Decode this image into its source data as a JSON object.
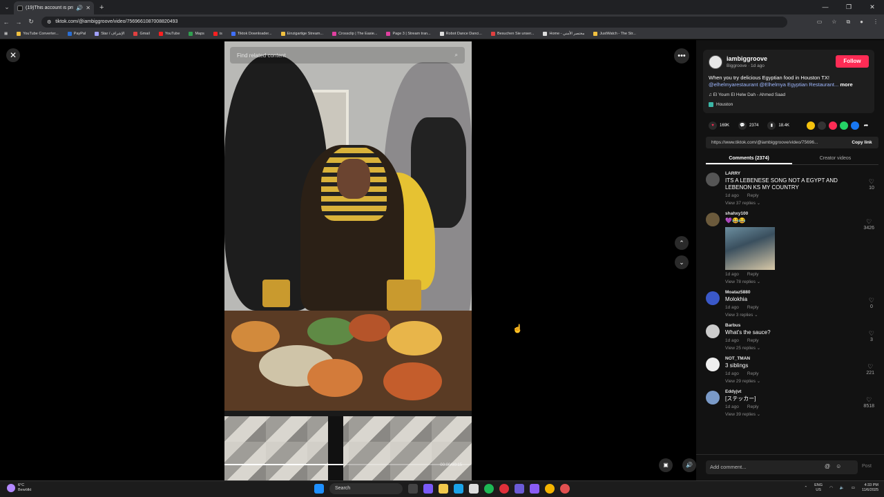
{
  "browser": {
    "tab_title": "(19)This account is private.",
    "url": "tiktok.com/@iambiggroove/video/7569661087008820493",
    "bookmarks": [
      {
        "label": "YouTube Converter...",
        "color": "#f0c040"
      },
      {
        "label": "PayPal",
        "color": "#2a6fd6"
      },
      {
        "label": "Star / الإشراف",
        "color": "#a0a0ff"
      },
      {
        "label": "Gmail",
        "color": "#e04040"
      },
      {
        "label": "YouTube",
        "color": "#ff2020"
      },
      {
        "label": "Maps",
        "color": "#30a050"
      },
      {
        "label": "is",
        "color": "#ff2020"
      },
      {
        "label": "Tiktok Downloader...",
        "color": "#4070ff"
      },
      {
        "label": "Einzigartige Stream...",
        "color": "#f0c040"
      },
      {
        "label": "Crossclip | The Easie...",
        "color": "#e040a0"
      },
      {
        "label": "Page 3 | Stream tran...",
        "color": "#e040a0"
      },
      {
        "label": "Robot Dance Danci...",
        "color": "#dddddd"
      },
      {
        "label": "Besuchen Sie unser...",
        "color": "#e04040"
      },
      {
        "label": "Home - مختصر الأمني",
        "color": "#dddddd"
      },
      {
        "label": "JustWatch - The Str...",
        "color": "#f0c040"
      }
    ]
  },
  "video": {
    "search_placeholder": "Find related content",
    "progress": 0.48,
    "timecode": "00:00/00:15"
  },
  "post": {
    "username": "iambiggroove",
    "sub": "Biggroove · 1d ago",
    "follow_label": "Follow",
    "description": "When you try delicious Egyptian food in Houston TX!",
    "tags": "@elhelmyarestaurant @Elhelmya Egyptian Restaurant...",
    "more_label": "more",
    "music": "♫  El Youm El Helw Dah - Ahmed Saad",
    "location": "Houston",
    "likes": "169K",
    "comments_count": "2374",
    "saves": "18.4K",
    "link": "https://www.tiktok.com/@iambiggroove/video/75696...",
    "copy_label": "Copy link",
    "tab_comments": "Comments (2374)",
    "tab_creator": "Creator videos",
    "add_comment_placeholder": "Add comment...",
    "post_label": "Post"
  },
  "comments": [
    {
      "user": "LARRY",
      "text": "ITS A LEBENESE SONG NOT A EGYPT AND LEBENON KS MY COUNTRY",
      "time": "1d ago",
      "reply": "Reply",
      "replies": "View 37 replies ⌄",
      "likes": "10",
      "avatar": "#555555"
    },
    {
      "user": "shahxy100",
      "text": "💜😂😂",
      "time": "1d ago",
      "reply": "Reply",
      "replies": "View 78 replies ⌄",
      "likes": "3426",
      "avatar": "#6b5a3c",
      "has_image": true
    },
    {
      "user": "Moataz5880",
      "text": "Molokhia",
      "time": "1d ago",
      "reply": "Reply",
      "replies": "View 3 replies ⌄",
      "likes": "0",
      "avatar": "#3a58c8"
    },
    {
      "user": "Barbus",
      "text": "What's the sauce?",
      "time": "1d ago",
      "reply": "Reply",
      "replies": "View 25 replies ⌄",
      "likes": "3",
      "avatar": "#cccccc"
    },
    {
      "user": "NOT_TMAN",
      "text": "3 siblings",
      "time": "1d ago",
      "reply": "Reply",
      "replies": "View 29 replies ⌄",
      "likes": "221",
      "avatar": "#eeeeee"
    },
    {
      "user": "Eddyjvt",
      "text": "[ステッカー]",
      "time": "1d ago",
      "reply": "Reply",
      "replies": "View 39 replies ⌄",
      "likes": "8518",
      "avatar": "#7a9ac8"
    }
  ],
  "taskbar": {
    "temp": "6°C",
    "weather": "Bewölkt",
    "search": "Search",
    "lang": "ENG",
    "region": "US",
    "time": "4:33 PM",
    "date": "11/6/2025"
  }
}
